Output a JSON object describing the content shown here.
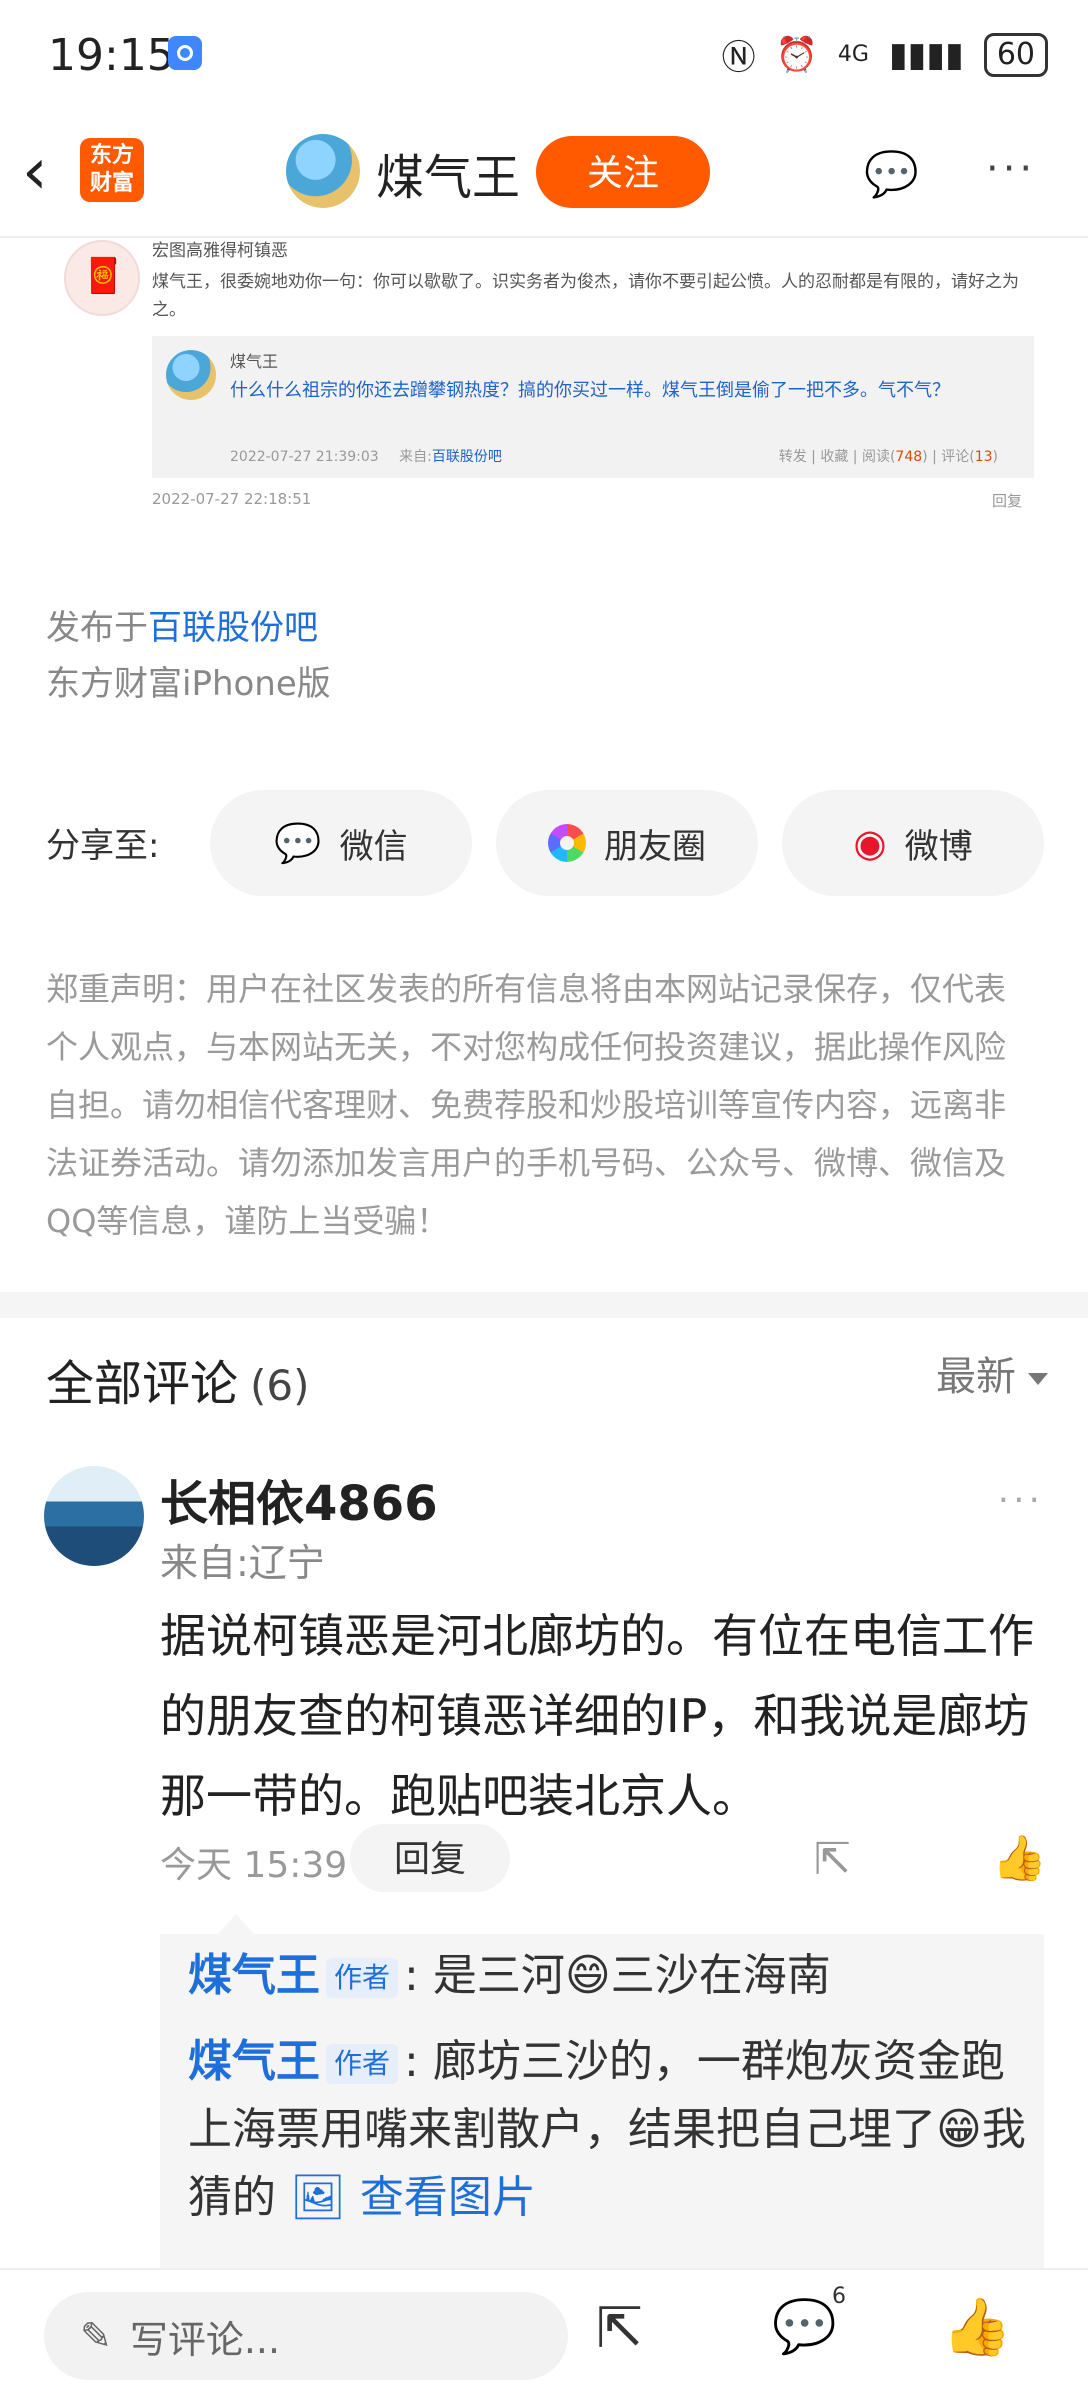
{
  "status_bar": {
    "time": "19:15",
    "signal": "4G",
    "battery": "60"
  },
  "nav": {
    "logo_text": "东方\n财富",
    "title": "煤气王",
    "follow": "关注",
    "more": "···"
  },
  "quoted": {
    "user": "宏图高雅得柯镇恶",
    "text": "煤气王，很委婉地劝你一句：你可以歇歇了。识实务者为俊杰，请你不要引起公愤。人的忍耐都是有限的，请好之为之。",
    "inner": {
      "name": "煤气王",
      "text": "什么什么祖宗的你还去蹭攀钢热度？搞的你买过一样。煤气王倒是偷了一把不多。气不气？",
      "date": "2022-07-27 21:39:03",
      "from_label": "来自:",
      "from": "百联股份吧",
      "stats": "转发 | 收藏 | 阅读(",
      "reads": "748",
      "comments_label": ") | 评论(",
      "comments": "13",
      "close": ")"
    },
    "date": "2022-07-27 22:18:51",
    "reply": "回复"
  },
  "published": {
    "prefix": "发布于",
    "bar": "百联股份吧",
    "device": "东方财富iPhone版"
  },
  "share": {
    "label": "分享至:",
    "wechat": "微信",
    "moments": "朋友圈",
    "weibo": "微博"
  },
  "disclaimer": "郑重声明：用户在社区发表的所有信息将由本网站记录保存，仅代表个人观点，与本网站无关，不对您构成任何投资建议，据此操作风险自担。请勿相信代客理财、免费荐股和炒股培训等宣传内容，远离非法证券活动。请勿添加发言用户的手机号码、公众号、微博、微信及QQ等信息，谨防上当受骗！",
  "comments": {
    "title": "全部评论",
    "count": "(6)",
    "sort": "最新",
    "item": {
      "name": "长相依4866",
      "location": "来自:辽宁",
      "body": "据说柯镇恶是河北廊坊的。有位在电信工作的朋友查的柯镇恶详细的IP，和我说是廊坊那一带的。跑贴吧装北京人。",
      "time": "今天 15:39",
      "reply": "回复",
      "replies": [
        {
          "name": "煤气王",
          "tag": "作者",
          "text": ": 是三河😄三沙在海南"
        },
        {
          "name": "煤气王",
          "tag": "作者",
          "text": ": 廊坊三沙的，一群炮灰资金跑上海票用嘴来割散户，结果把自己埋了😁我猜的",
          "pic": "查看图片"
        }
      ]
    }
  },
  "bottom": {
    "placeholder": "写评论...",
    "comment_count": "6"
  }
}
